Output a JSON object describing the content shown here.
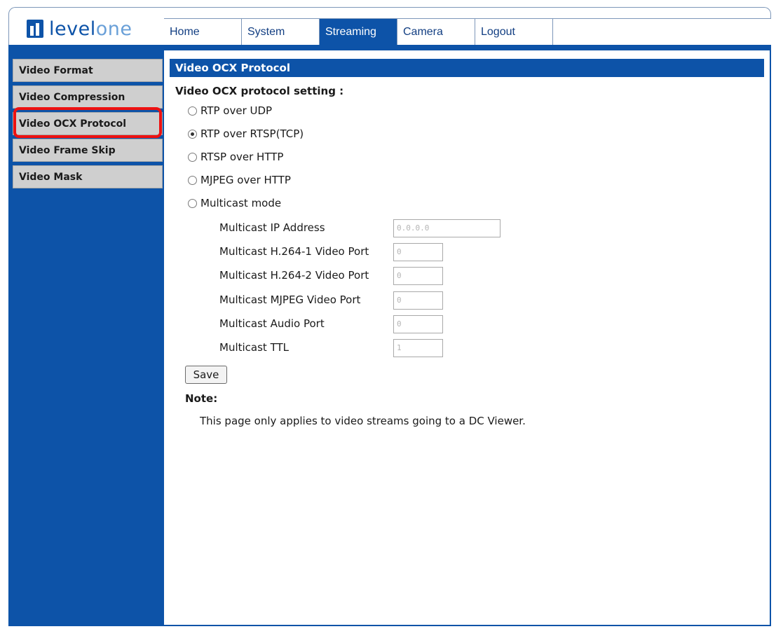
{
  "brand": {
    "logo_text_level": "level",
    "logo_text_one": "one",
    "logo_icon": "levelone-logo-icon",
    "primary_color": "#0d53a8",
    "highlight_color": "#ee1111"
  },
  "nav": {
    "tabs": [
      {
        "label": "Home",
        "active": false
      },
      {
        "label": "System",
        "active": false
      },
      {
        "label": "Streaming",
        "active": true
      },
      {
        "label": "Camera",
        "active": false
      },
      {
        "label": "Logout",
        "active": false
      }
    ]
  },
  "sidebar": {
    "items": [
      {
        "label": "Video Format"
      },
      {
        "label": "Video Compression"
      },
      {
        "label": "Video OCX Protocol",
        "selected": true
      },
      {
        "label": "Video Frame Skip"
      },
      {
        "label": "Video Mask"
      }
    ]
  },
  "main": {
    "title": "Video OCX Protocol",
    "heading": "Video OCX protocol setting :",
    "options": [
      {
        "label": "RTP over UDP",
        "checked": false
      },
      {
        "label": "RTP over RTSP(TCP)",
        "checked": true
      },
      {
        "label": "RTSP over HTTP",
        "checked": false
      },
      {
        "label": "MJPEG over HTTP",
        "checked": false
      },
      {
        "label": "Multicast mode",
        "checked": false
      }
    ],
    "multicast_fields": [
      {
        "label": "Multicast IP Address",
        "value": "0.0.0.0"
      },
      {
        "label": "Multicast H.264-1 Video Port",
        "value": "0"
      },
      {
        "label": "Multicast H.264-2 Video Port",
        "value": "0"
      },
      {
        "label": "Multicast MJPEG Video Port",
        "value": "0"
      },
      {
        "label": "Multicast Audio Port",
        "value": "0"
      },
      {
        "label": "Multicast TTL",
        "value": "1"
      }
    ],
    "save_label": "Save",
    "note_label": "Note:",
    "note_text": "This page only applies to video streams going to a DC Viewer."
  }
}
